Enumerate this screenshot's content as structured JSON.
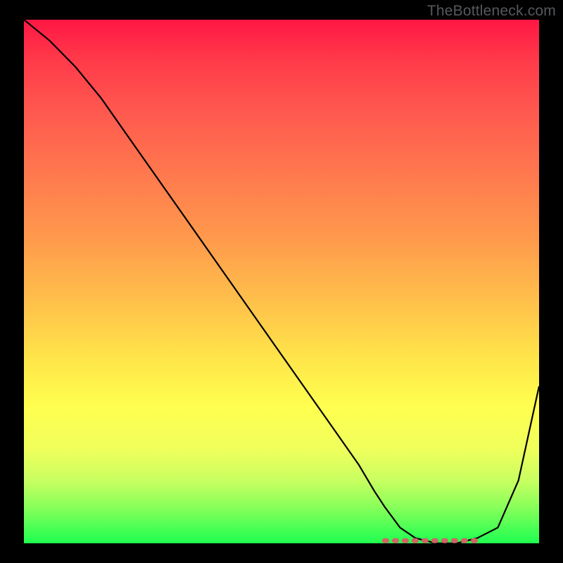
{
  "watermark": "TheBottleneck.com",
  "chart_data": {
    "type": "line",
    "title": "",
    "xlabel": "",
    "ylabel": "",
    "xlim": [
      0,
      100
    ],
    "ylim": [
      0,
      100
    ],
    "series": [
      {
        "name": "bottleneck-curve",
        "x": [
          0,
          5,
          10,
          15,
          20,
          25,
          30,
          35,
          40,
          45,
          50,
          55,
          60,
          65,
          68,
          70,
          73,
          76,
          80,
          84,
          88,
          92,
          96,
          100
        ],
        "values": [
          100,
          96,
          91,
          85,
          78,
          71,
          64,
          57,
          50,
          43,
          36,
          29,
          22,
          15,
          10,
          7,
          3,
          1,
          0,
          0,
          1,
          3,
          12,
          30
        ]
      }
    ],
    "flat_region": {
      "x_start": 70,
      "x_end": 88,
      "y": 0.5
    },
    "background": "rainbow-gradient-vertical"
  },
  "colors": {
    "curve": "#000000",
    "flat_marker": "#d26264",
    "watermark": "#555a5c",
    "frame": "#000000"
  }
}
